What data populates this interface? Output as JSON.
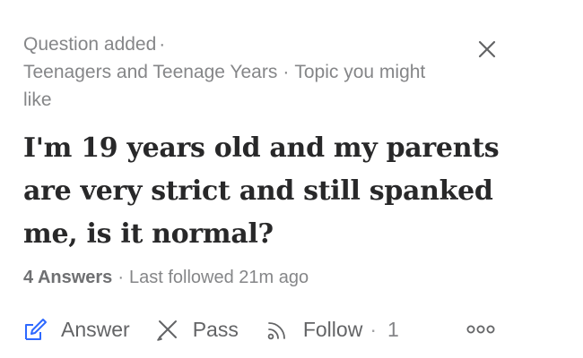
{
  "meta": {
    "status": "Question added",
    "topic": "Teenagers and Teenage Years",
    "topic_note": "Topic you might like",
    "separator": "·"
  },
  "question": {
    "title": "I'm 19 years old and my parents are very strict and still spanked me, is it normal?"
  },
  "stats": {
    "answers": "4 Answers",
    "last_followed": "Last followed 21m ago",
    "separator": "·"
  },
  "actions": {
    "answer_label": "Answer",
    "pass_label": "Pass",
    "follow_label": "Follow",
    "follow_count": "1",
    "separator": "·"
  },
  "icons": {
    "close": "close-icon",
    "answer": "pencil-icon",
    "pass": "pass-icon",
    "follow": "follow-icon",
    "more": "more-options-icon"
  },
  "colors": {
    "accent": "#2e69ff",
    "text": "#282829",
    "muted": "#858688"
  }
}
